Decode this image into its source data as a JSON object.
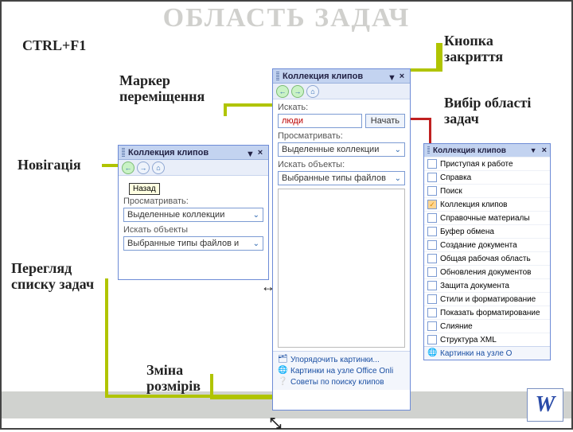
{
  "title": "ОБЛАСТЬ ЗАДАЧ",
  "labels": {
    "ctrl": "CTRL+F1",
    "moveMarker": "Маркер\nпереміщення",
    "navigation": "Новігація",
    "taskList": "Перегляд\nсписку задач",
    "resize": "Зміна\nрозмірів",
    "closeBtn": "Кнопка\nзакриття",
    "chooseArea": "Вибір області\nзадач",
    "backTip": "Назад"
  },
  "paneLeft": {
    "title": "Коллекция клипов",
    "lookIn": "Просматривать:",
    "lookInVal": "Выделенные коллекции",
    "searchObj": "Искать объекты",
    "searchObjVal": "Выбранные типы файлов и"
  },
  "paneMid": {
    "title": "Коллекция клипов",
    "search": "Искать:",
    "searchVal": "люди",
    "go": "Начать",
    "lookIn": "Просматривать:",
    "lookInVal": "Выделенные коллекции",
    "searchObj": "Искать объекты:",
    "searchObjVal": "Выбранные типы файлов",
    "link1": "Упорядочить картинки...",
    "link2": "Картинки на узле Office Onli",
    "link3": "Советы по поиску клипов"
  },
  "menu": {
    "title": "Коллекция клипов",
    "items": [
      "Приступая к работе",
      "Справка",
      "Поиск",
      "Коллекция клипов",
      "Справочные материалы",
      "Буфер обмена",
      "Создание документа",
      "Общая рабочая область",
      "Обновления документов",
      "Защита документа",
      "Стили и форматирование",
      "Показать форматирование",
      "Слияние",
      "Структура XML"
    ],
    "footer": "Картинки на узле O"
  }
}
